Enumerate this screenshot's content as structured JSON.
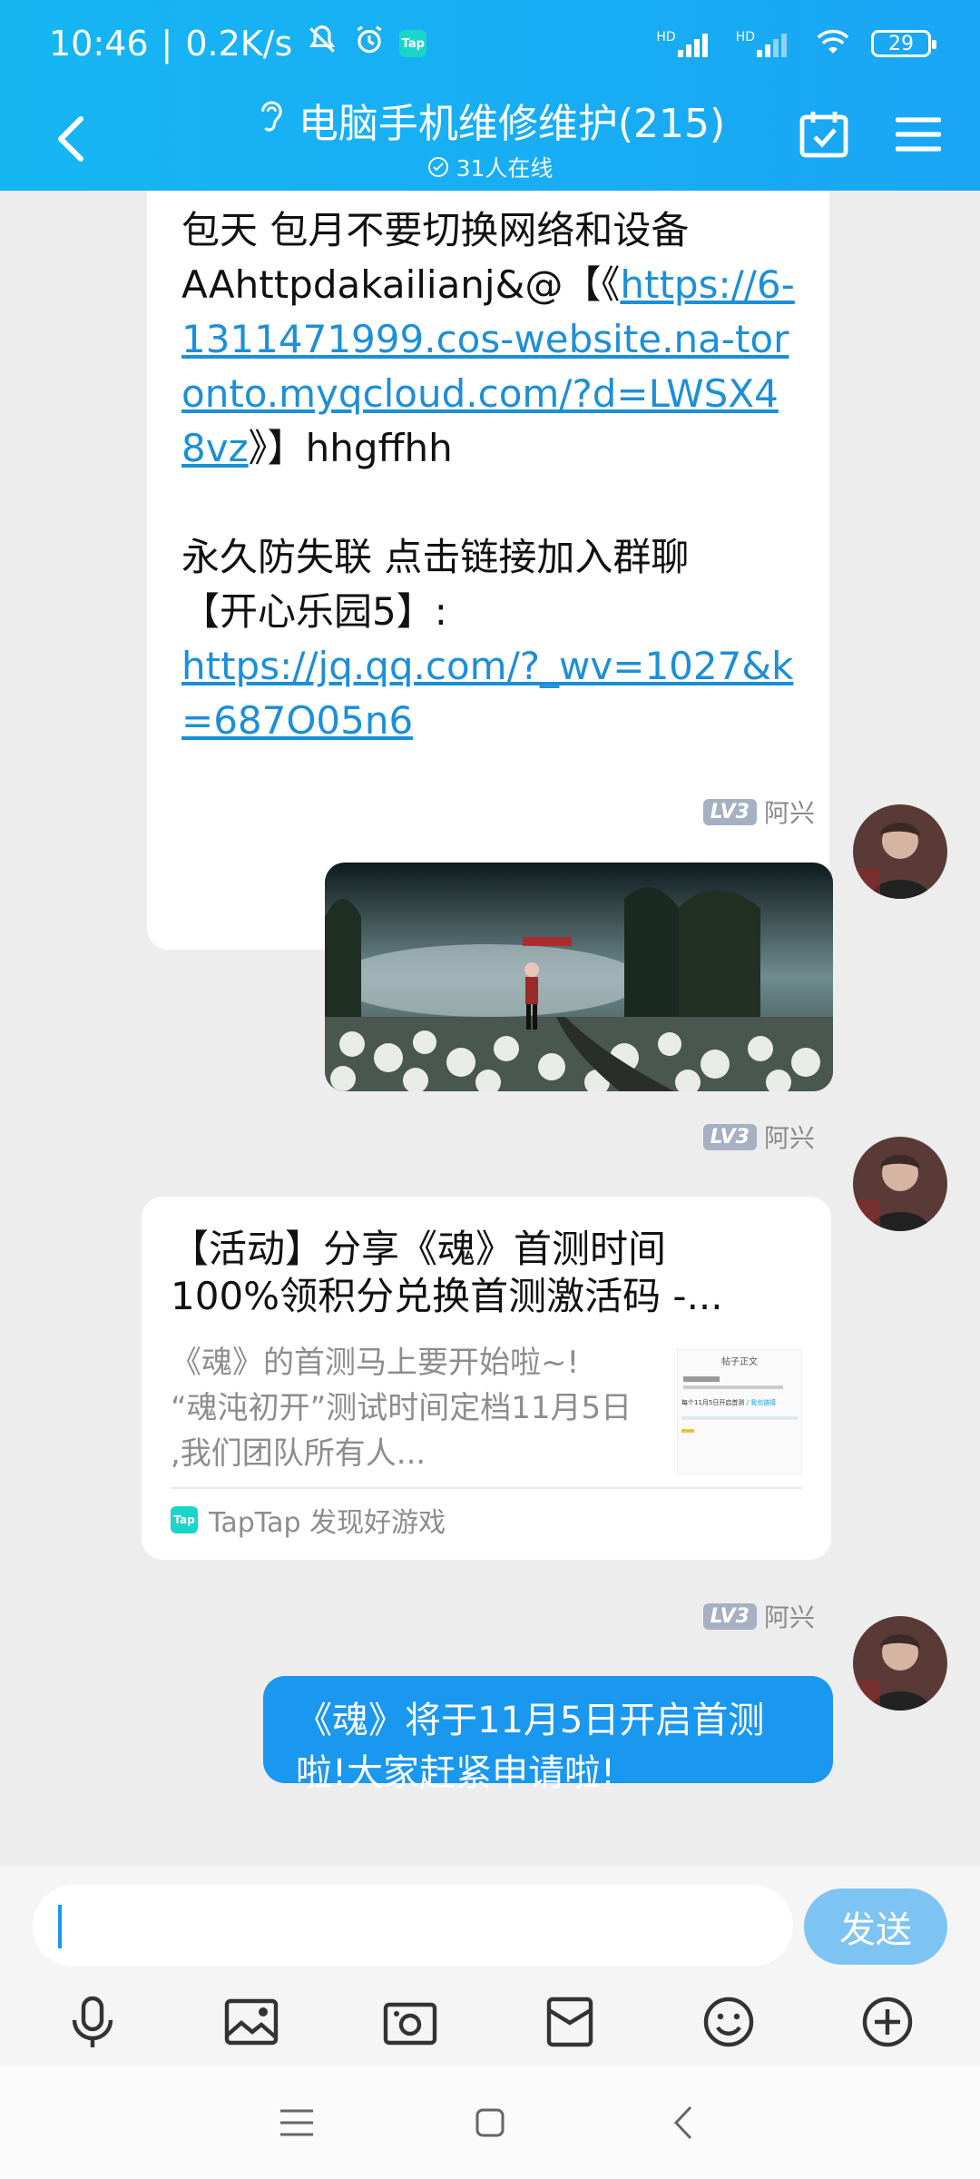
{
  "status": {
    "time": "10:46",
    "speed": "0.2K/s",
    "tap_label": "Tap",
    "hd1": "HD",
    "hd2": "HD",
    "battery": "29"
  },
  "header": {
    "title": "电脑手机维修维护(215)",
    "online": "31人在线"
  },
  "messages": {
    "m1": {
      "line1": "包天 包月不要切换网络和设备",
      "line2_prefix": "AAhttpdakailianj&@【《",
      "link1": "https://6-1311471999.cos-website.na-toronto.myqcloud.com/?d=LWSX48vz",
      "line2_suffix": "》】hhgffhh",
      "line3": "永久防失联 点击链接加入群聊",
      "line4": "【开心乐园5】:",
      "link2": "https://jq.qq.com/?_wv=1027&k=687O05n6"
    },
    "sender_level": "LV3",
    "sender_name": "阿兴",
    "card": {
      "title": "【活动】分享《魂》首测时间100%领积分兑换首测激活码 -...",
      "title_line1": "【活动】分享《魂》首测时间",
      "title_line2": "100%领积分兑换首测激活码 -...",
      "desc1": "《魂》的首测马上要开始啦~!",
      "desc2": "“魂沌初开”测试时间定档11月5日",
      "desc3": ",我们团队所有人...",
      "thumb_title": "帖子正文",
      "thumb_line": "每个11月5日开启首测 ",
      "thumb_link": "/ 我也链接",
      "source": "TapTap 发现好游戏",
      "tap_label": "Tap"
    },
    "last": {
      "line1": "《魂》将于11月5日开启首测",
      "line2": "啦!大家赶紧申请啦!"
    }
  },
  "input": {
    "send_label": "发送",
    "value": ""
  },
  "colors": {
    "header": "#16b6f3",
    "bubble_blue": "#1a97ef",
    "send_button": "#7ec4f3",
    "link": "#1c8fd8"
  }
}
